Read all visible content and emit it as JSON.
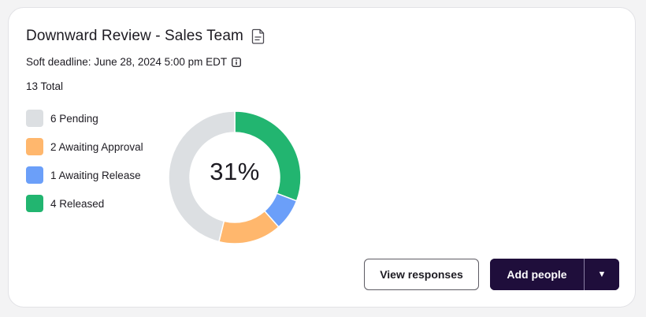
{
  "review": {
    "title": "Downward Review - Sales Team",
    "deadline": "Soft deadline: June 28, 2024 5:00 pm EDT",
    "total": "13 Total",
    "percent": "31%"
  },
  "chart_data": {
    "type": "pie",
    "labels": [
      "Pending",
      "Awaiting Approval",
      "Awaiting Release",
      "Released"
    ],
    "values": [
      6,
      2,
      1,
      4
    ],
    "colors": [
      "#dcdfe2",
      "#ffb76d",
      "#6b9ff9",
      "#22b570"
    ],
    "center_text": "31%"
  },
  "legend": [
    {
      "label": "6 Pending",
      "color": "#dcdfe2"
    },
    {
      "label": "2 Awaiting Approval",
      "color": "#ffb76d"
    },
    {
      "label": "1 Awaiting Release",
      "color": "#6b9ff9"
    },
    {
      "label": "4 Released",
      "color": "#22b570"
    }
  ],
  "actions": {
    "view_responses": "View responses",
    "add_people": "Add people",
    "caret": "▼"
  },
  "icons": {
    "title_icon": "document-icon",
    "deadline_icon": "info-icon",
    "dropdown_icon": "caret-down-icon"
  }
}
